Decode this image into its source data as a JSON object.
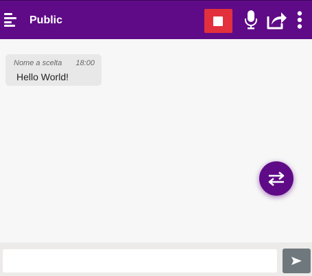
{
  "header": {
    "menu_icon": "menu-icon",
    "title": "Public",
    "stop_icon": "stop-icon",
    "mic_icon": "microphone-icon",
    "share_icon": "share-icon",
    "more_icon": "more-vertical-icon"
  },
  "messages": [
    {
      "author": "Nome a scelta",
      "time": "18:00",
      "text": "Hello World!"
    }
  ],
  "fab": {
    "icon": "swap-icon"
  },
  "composer": {
    "value": "",
    "placeholder": "",
    "send_icon": "send-icon"
  },
  "colors": {
    "primary": "#5f0b87",
    "stop": "#e2313d",
    "bubble": "#e8e8e8",
    "background": "#f7f7f7",
    "send": "#6f787c"
  }
}
